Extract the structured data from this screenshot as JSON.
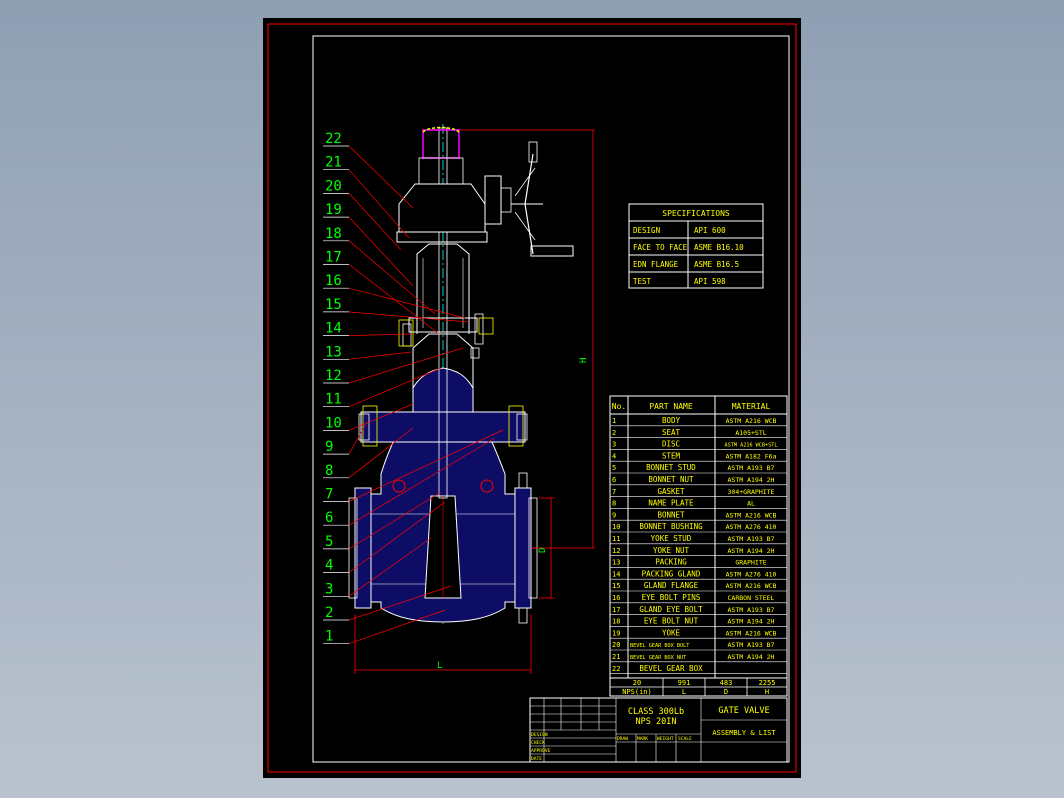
{
  "colors": {
    "background": "#000000",
    "frame": "#ff0000",
    "inner_frame": "#ffffff",
    "text_green": "#00ff00",
    "text_yellow": "#ffff00",
    "text_white": "#ffffff",
    "valve_body": "#1a1a8c",
    "leader": "#ff0000"
  },
  "balloons": [
    "22",
    "21",
    "20",
    "19",
    "18",
    "17",
    "16",
    "15",
    "14",
    "13",
    "12",
    "11",
    "10",
    "9",
    "8",
    "7",
    "6",
    "5",
    "4",
    "3",
    "2",
    "1"
  ],
  "dimensions": {
    "h_label": "H",
    "d_label": "D",
    "l_label": "L"
  },
  "specifications": {
    "title": "SPECIFICATIONS",
    "rows": [
      {
        "key": "DESIGN",
        "value": "API 600"
      },
      {
        "key": "FACE TO FACE",
        "value": "ASME B16.10"
      },
      {
        "key": "EDN FLANGE",
        "value": "ASME B16.5"
      },
      {
        "key": "TEST",
        "value": "API 598"
      }
    ]
  },
  "parts": {
    "headers": [
      "No.",
      "PART NAME",
      "MATERIAL"
    ],
    "rows": [
      {
        "no": "1",
        "name": "BODY",
        "material": "ASTM A216 WCB"
      },
      {
        "no": "2",
        "name": "SEAT",
        "material": "A105+STL"
      },
      {
        "no": "3",
        "name": "DISC",
        "material": "ASTM A216 WCB+STL"
      },
      {
        "no": "4",
        "name": "STEM",
        "material": "ASTM A182 F6a"
      },
      {
        "no": "5",
        "name": "BONNET STUD",
        "material": "ASTM A193 B7"
      },
      {
        "no": "6",
        "name": "BONNET NUT",
        "material": "ASTM A194 2H"
      },
      {
        "no": "7",
        "name": "GASKET",
        "material": "304+GRAPHITE"
      },
      {
        "no": "8",
        "name": "NAME PLATE",
        "material": "AL"
      },
      {
        "no": "9",
        "name": "BONNET",
        "material": "ASTM A216 WCB"
      },
      {
        "no": "10",
        "name": "BONNET BUSHING",
        "material": "ASTM A276 410"
      },
      {
        "no": "11",
        "name": "YOKE STUD",
        "material": "ASTM A193 B7"
      },
      {
        "no": "12",
        "name": "YOKE NUT",
        "material": "ASTM A194 2H"
      },
      {
        "no": "13",
        "name": "PACKING",
        "material": "GRAPHITE"
      },
      {
        "no": "14",
        "name": "PACKING GLAND",
        "material": "ASTM A276 410"
      },
      {
        "no": "15",
        "name": "GLAND FLANGE",
        "material": "ASTM A216 WCB"
      },
      {
        "no": "16",
        "name": "EYE BOLT PINS",
        "material": "CARBON STEEL"
      },
      {
        "no": "17",
        "name": "GLAND EYE BOLT",
        "material": "ASTM A193 B7"
      },
      {
        "no": "18",
        "name": "EYE BOLT NUT",
        "material": "ASTM A194 2H"
      },
      {
        "no": "19",
        "name": "YOKE",
        "material": "ASTM A216 WCB"
      },
      {
        "no": "20",
        "name": "BEVEL GEAR BOX BOLT",
        "material": "ASTM A193 B7"
      },
      {
        "no": "21",
        "name": "BEVEL GEAR BOX NUT",
        "material": "ASTM A194 2H"
      },
      {
        "no": "22",
        "name": "BEVEL GEAR BOX",
        "material": ""
      }
    ]
  },
  "size_table": {
    "values": [
      "20",
      "991",
      "483",
      "2255"
    ],
    "labels": [
      "NPS(in)",
      "L",
      "D",
      "H"
    ]
  },
  "title_block": {
    "class_line1": "CLASS 300Lb",
    "class_line2": "NPS 20IN",
    "title": "GATE VALVE",
    "subtitle": "ASSEMBLY & LIST",
    "sign_rows": [
      "DESIGN",
      "CHECK",
      "APPROVE",
      "DATE"
    ],
    "mid_headers": [
      "DRAW",
      "MARK",
      "WEIGHT",
      "SCALE"
    ]
  }
}
